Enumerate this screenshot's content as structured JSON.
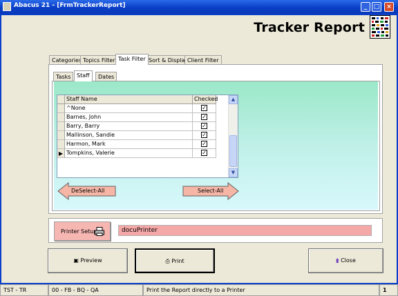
{
  "window": {
    "title": "Abacus 21 - [FrmTrackerReport]",
    "controls": [
      "_",
      "□",
      "×"
    ]
  },
  "header": {
    "report_title": "Tracker Report",
    "logo_icon": "tracker-grid-logo"
  },
  "tabs": [
    {
      "label": "Categories",
      "active": false
    },
    {
      "label": "Topics Filter",
      "active": false
    },
    {
      "label": "Task Filter",
      "active": true
    },
    {
      "label": "Sort & Display",
      "active": false
    },
    {
      "label": "Client Filter",
      "active": false
    }
  ],
  "subtabs": [
    {
      "label": "Tasks",
      "active": false
    },
    {
      "label": "Staff",
      "active": true
    },
    {
      "label": "Dates",
      "active": false
    }
  ],
  "staff_grid": {
    "columns": [
      "Staff Name",
      "Checked"
    ],
    "rows": [
      {
        "name": "^None",
        "checked": true,
        "current": false
      },
      {
        "name": "Barnes, John",
        "checked": true,
        "current": false
      },
      {
        "name": "Barry, Barry",
        "checked": true,
        "current": false
      },
      {
        "name": "Mallinson, Sandie",
        "checked": true,
        "current": false
      },
      {
        "name": "Harmon, Mark",
        "checked": true,
        "current": false
      },
      {
        "name": "Tompkins, Valerie",
        "checked": true,
        "current": true
      }
    ]
  },
  "selection_buttons": {
    "deselect_all": "DeSelect-All",
    "select_all": "Select-All"
  },
  "printer": {
    "setup_label": "Printer Setup",
    "printer_name": "docuPrinter"
  },
  "actions": {
    "preview": "Preview",
    "print": "Print",
    "close": "Close"
  },
  "statusbar": {
    "left": "TST - TR",
    "middle": "00 - FB - BQ - QA",
    "message": "Print the Report directly to a Printer",
    "right": "1"
  },
  "colors": {
    "titlebar": "#0a3fc8",
    "panel_gradient_top": "#9be8c8",
    "panel_gradient_bottom": "#d8f8fc",
    "arrow_fill": "#f6b6a6",
    "printer_field": "#f5a8a8"
  }
}
